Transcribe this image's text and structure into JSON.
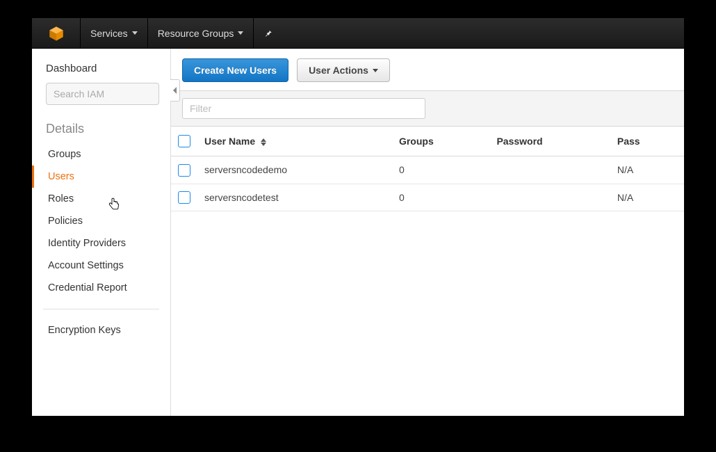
{
  "topnav": {
    "services": "Services",
    "resource_groups": "Resource Groups"
  },
  "sidebar": {
    "dashboard": "Dashboard",
    "search_placeholder": "Search IAM",
    "details_heading": "Details",
    "items": [
      {
        "label": "Groups"
      },
      {
        "label": "Users"
      },
      {
        "label": "Roles"
      },
      {
        "label": "Policies"
      },
      {
        "label": "Identity Providers"
      },
      {
        "label": "Account Settings"
      },
      {
        "label": "Credential Report"
      }
    ],
    "encryption_keys": "Encryption Keys"
  },
  "actions": {
    "create": "Create New Users",
    "user_actions": "User Actions"
  },
  "filter_placeholder": "Filter",
  "table": {
    "headers": {
      "user_name": "User Name",
      "groups": "Groups",
      "password": "Password",
      "password_last_used": "Pass"
    },
    "rows": [
      {
        "user_name": "serversncodedemo",
        "groups": "0",
        "password": "",
        "password_last_used": "N/A"
      },
      {
        "user_name": "serversncodetest",
        "groups": "0",
        "password": "",
        "password_last_used": "N/A"
      }
    ]
  }
}
